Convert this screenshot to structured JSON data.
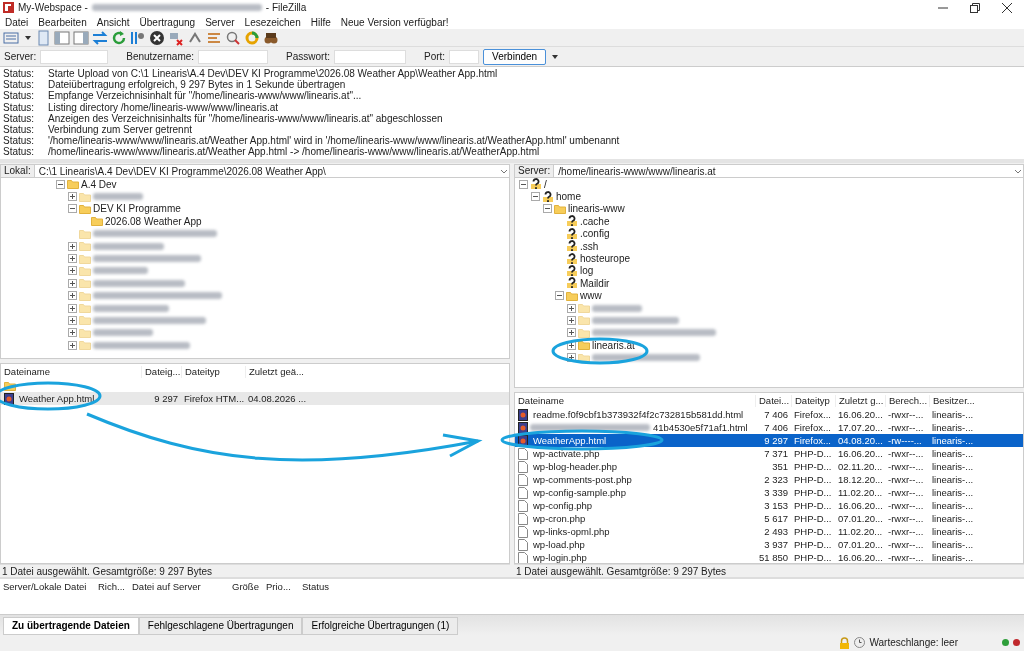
{
  "window": {
    "title_start": "My-Webspace -",
    "title_end": "- FileZilla"
  },
  "menu": [
    "Datei",
    "Bearbeiten",
    "Ansicht",
    "Übertragung",
    "Server",
    "Lesezeichen",
    "Hilfe",
    "Neue Version verfügbar!"
  ],
  "quickconnect": {
    "fields": [
      {
        "label": "Server:"
      },
      {
        "label": "Benutzername:"
      },
      {
        "label": "Passwort:"
      },
      {
        "label": "Port:"
      }
    ],
    "button": "Verbinden"
  },
  "log": [
    {
      "label": "Status:",
      "message": "Starte Upload von C:\\1 Linearis\\A.4 Dev\\DEV KI Programme\\2026.08 Weather App\\Weather App.html"
    },
    {
      "label": "Status:",
      "message": "Dateiübertragung erfolgreich, 9 297 Bytes in 1 Sekunde übertragen"
    },
    {
      "label": "Status:",
      "message": "Empfange Verzeichnisinhalt für \"/home/linearis-www/www/linearis.at\"..."
    },
    {
      "label": "Status:",
      "message": "Listing directory /home/linearis-www/www/linearis.at"
    },
    {
      "label": "Status:",
      "message": "Anzeigen des Verzeichnisinhalts für \"/home/linearis-www/www/linearis.at\" abgeschlossen"
    },
    {
      "label": "Status:",
      "message": "Verbindung zum Server getrennt"
    },
    {
      "label": "Status:",
      "message": "'/home/linearis-www/www/linearis.at/Weather App.html' wird in '/home/linearis-www/www/linearis.at/WeatherApp.html' umbenannt"
    },
    {
      "label": "Status:",
      "message": "/home/linearis-www/www/linearis.at/Weather App.html -> /home/linearis-www/www/linearis.at/WeatherApp.html"
    }
  ],
  "local": {
    "path_label": "Lokal:",
    "path": "C:\\1 Linearis\\A.4 Dev\\DEV KI Programme\\2026.08 Weather App\\",
    "focused": false,
    "tree": [
      {
        "kind": "folder",
        "label": "A.4 Dev",
        "expanded": true,
        "children": [
          {
            "kind": "blurred",
            "expanded": false
          },
          {
            "kind": "folder",
            "label": "DEV KI Programme",
            "expanded": true,
            "children": [
              {
                "kind": "folder",
                "label": "2026.08 Weather App"
              }
            ]
          },
          {
            "kind": "blurred"
          },
          {
            "kind": "blurred",
            "expanded": false
          },
          {
            "kind": "blurred",
            "expanded": false
          },
          {
            "kind": "blurred",
            "expanded": false
          },
          {
            "kind": "blurred",
            "expanded": false
          },
          {
            "kind": "blurred",
            "expanded": false
          },
          {
            "kind": "blurred",
            "expanded": false
          },
          {
            "kind": "blurred",
            "expanded": false
          },
          {
            "kind": "blurred",
            "expanded": false
          },
          {
            "kind": "blurred",
            "expanded": false
          }
        ]
      }
    ],
    "columns": [
      "Dateiname",
      "Dateig...",
      "Dateityp",
      "Zuletzt geä..."
    ],
    "files": [
      {
        "kind": "parent",
        "selected": false
      },
      {
        "kind": "html",
        "cells": [
          "Weather App.html",
          "9 297",
          "Firefox HTM...",
          "04.08.2026 ..."
        ],
        "selected": true
      }
    ],
    "status": "1 Datei ausgewählt. Gesamtgröße: 9 297 Bytes"
  },
  "remote": {
    "path_label": "Server:",
    "path": "/home/linearis-www/www/linearis.at",
    "focused": true,
    "tree": [
      {
        "kind": "unknown",
        "label": "/",
        "expanded": true,
        "children": [
          {
            "kind": "unknown",
            "label": "home",
            "expanded": true,
            "children": [
              {
                "kind": "folder",
                "label": "linearis-www",
                "expanded": true,
                "children": [
                  {
                    "kind": "unknown",
                    "label": ".cache"
                  },
                  {
                    "kind": "unknown",
                    "label": ".config"
                  },
                  {
                    "kind": "unknown",
                    "label": ".ssh"
                  },
                  {
                    "kind": "unknown",
                    "label": "hosteurope"
                  },
                  {
                    "kind": "unknown",
                    "label": "log"
                  },
                  {
                    "kind": "unknown",
                    "label": "Maildir"
                  },
                  {
                    "kind": "folder",
                    "label": "www",
                    "expanded": true,
                    "children": [
                      {
                        "kind": "blurred",
                        "expanded": false
                      },
                      {
                        "kind": "blurred",
                        "expanded": false
                      },
                      {
                        "kind": "blurred",
                        "expanded": false
                      },
                      {
                        "kind": "folder",
                        "label": "linearis.at",
                        "expanded": false
                      },
                      {
                        "kind": "blurred",
                        "expanded": false
                      }
                    ]
                  }
                ]
              }
            ]
          }
        ]
      }
    ],
    "columns": [
      "Dateiname",
      "Datei...",
      "Dateityp",
      "Zuletzt g...",
      "Berech...",
      "Besitzer..."
    ],
    "files": [
      {
        "kind": "html",
        "obscured": false,
        "cells": [
          "readme.f0f9cbf1b373932f4f2c732815b581dd.html",
          "7 406",
          "Firefox...",
          "16.06.20...",
          "-rwxr--...",
          "linearis-..."
        ],
        "selected": false
      },
      {
        "kind": "html",
        "obscured": true,
        "cells": [
          "41b4530e5f71af1.html",
          "7 406",
          "Firefox...",
          "17.07.20...",
          "-rwxr--...",
          "linearis-..."
        ],
        "selected": false
      },
      {
        "kind": "html",
        "obscured": false,
        "cells": [
          "WeatherApp.html",
          "9 297",
          "Firefox...",
          "04.08.20...",
          "-rw----...",
          "linearis-..."
        ],
        "selected": true
      },
      {
        "kind": "php",
        "obscured": false,
        "cells": [
          "wp-activate.php",
          "7 371",
          "PHP-D...",
          "16.06.20...",
          "-rwxr--...",
          "linearis-..."
        ],
        "selected": false
      },
      {
        "kind": "php",
        "obscured": false,
        "cells": [
          "wp-blog-header.php",
          "351",
          "PHP-D...",
          "02.11.20...",
          "-rwxr--...",
          "linearis-..."
        ],
        "selected": false
      },
      {
        "kind": "php",
        "obscured": false,
        "cells": [
          "wp-comments-post.php",
          "2 323",
          "PHP-D...",
          "18.12.20...",
          "-rwxr--...",
          "linearis-..."
        ],
        "selected": false
      },
      {
        "kind": "php",
        "obscured": false,
        "cells": [
          "wp-config-sample.php",
          "3 339",
          "PHP-D...",
          "11.02.20...",
          "-rwxr--...",
          "linearis-..."
        ],
        "selected": false
      },
      {
        "kind": "php",
        "obscured": false,
        "cells": [
          "wp-config.php",
          "3 153",
          "PHP-D...",
          "16.06.20...",
          "-rwxr--...",
          "linearis-..."
        ],
        "selected": false
      },
      {
        "kind": "php",
        "obscured": false,
        "cells": [
          "wp-cron.php",
          "5 617",
          "PHP-D...",
          "07.01.20...",
          "-rwxr--...",
          "linearis-..."
        ],
        "selected": false
      },
      {
        "kind": "php",
        "obscured": false,
        "cells": [
          "wp-links-opml.php",
          "2 493",
          "PHP-D...",
          "11.02.20...",
          "-rwxr--...",
          "linearis-..."
        ],
        "selected": false
      },
      {
        "kind": "php",
        "obscured": false,
        "cells": [
          "wp-load.php",
          "3 937",
          "PHP-D...",
          "07.01.20...",
          "-rwxr--...",
          "linearis-..."
        ],
        "selected": false
      },
      {
        "kind": "php",
        "obscured": false,
        "cells": [
          "wp-login.php",
          "51 850",
          "PHP-D...",
          "16.06.20...",
          "-rwxr--...",
          "linearis-..."
        ],
        "selected": false
      }
    ],
    "status": "1 Datei ausgewählt. Gesamtgröße: 9 297 Bytes"
  },
  "queue": {
    "columns": [
      "Server/Lokale Datei",
      "Rich...",
      "Datei auf Server",
      "Größe",
      "Prio...",
      "Status"
    ]
  },
  "tabs": [
    {
      "label": "Zu übertragende Dateien",
      "selected": true
    },
    {
      "label": "Fehlgeschlagene Übertragungen",
      "selected": false
    },
    {
      "label": "Erfolgreiche Übertragungen (1)",
      "selected": false
    }
  ],
  "status_bar": {
    "queue": "Warteschlange: leer",
    "lights": [
      {
        "color": "#2e9e3a"
      },
      {
        "color": "#c0282d"
      }
    ]
  }
}
